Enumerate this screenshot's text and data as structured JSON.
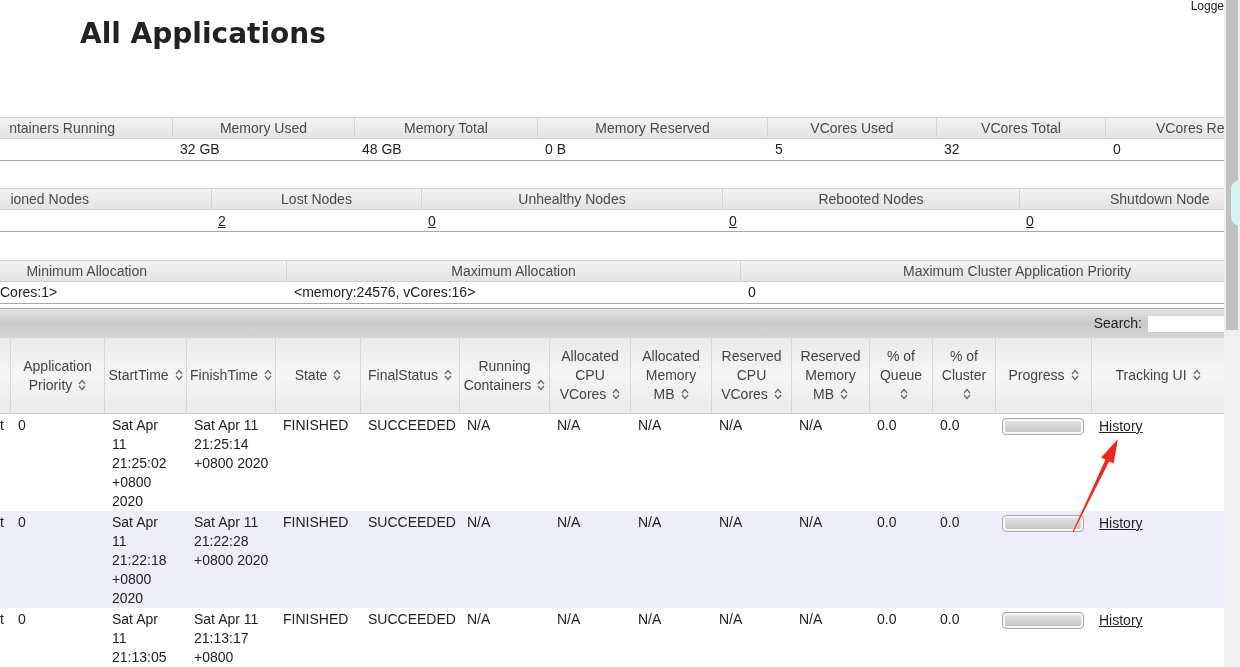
{
  "header": {
    "user_label": "Logge",
    "title": "All Applications"
  },
  "metric_tables": [
    {
      "columns": [
        {
          "label": "ntainers Running"
        },
        {
          "label": "Memory Used",
          "value": "32 GB",
          "kind": "text"
        },
        {
          "label": "Memory Total",
          "value": "48 GB",
          "kind": "text"
        },
        {
          "label": "Memory Reserved",
          "value": "0 B",
          "kind": "text"
        },
        {
          "label": "VCores Used",
          "value": "5",
          "kind": "text"
        },
        {
          "label": "VCores Total",
          "value": "32",
          "kind": "text"
        },
        {
          "label": "VCores Re",
          "value": "0",
          "kind": "text"
        }
      ]
    },
    {
      "columns": [
        {
          "label": "ioned Nodes"
        },
        {
          "label": "Lost Nodes",
          "value": "2",
          "kind": "link"
        },
        {
          "label": "Unhealthy Nodes",
          "value": "0",
          "kind": "link"
        },
        {
          "label": "Rebooted Nodes",
          "value": "0",
          "kind": "link"
        },
        {
          "label": "Shutdown Node",
          "value": "0",
          "kind": "link"
        }
      ]
    },
    {
      "columns": [
        {
          "label": "Minimum Allocation",
          "value": "Cores:1>",
          "kind": "text"
        },
        {
          "label": "Maximum Allocation",
          "value": "<memory:24576, vCores:16>",
          "kind": "text"
        },
        {
          "label": "Maximum Cluster Application Priority",
          "value": "0",
          "kind": "text"
        }
      ]
    }
  ],
  "applications_table": {
    "search": {
      "label": "Search:"
    },
    "columns": [
      {
        "label": "Application Priority",
        "sortable": true
      },
      {
        "label": "StartTime",
        "sortable": true
      },
      {
        "label": "FinishTime",
        "sortable": true
      },
      {
        "label": "State",
        "sortable": true
      },
      {
        "label": "FinalStatus",
        "sortable": true
      },
      {
        "label": "Running Containers",
        "sortable": true
      },
      {
        "label": "Allocated CPU VCores",
        "sortable": true
      },
      {
        "label": "Allocated Memory MB",
        "sortable": true
      },
      {
        "label": "Reserved CPU VCores",
        "sortable": true
      },
      {
        "label": "Reserved Memory MB",
        "sortable": true
      },
      {
        "label": "% of Queue",
        "sortable": true
      },
      {
        "label": "% of Cluster",
        "sortable": true
      },
      {
        "label": "Progress",
        "sortable": true
      },
      {
        "label": "Tracking UI",
        "sortable": true
      }
    ],
    "rows": [
      {
        "column_1": "t",
        "cells": [
          "0",
          "Sat Apr 11 21:25:02 +0800 2020",
          "Sat Apr 11 21:25:14 +0800 2020",
          "FINISHED",
          "SUCCEEDED",
          "N/A",
          "N/A",
          "N/A",
          "N/A",
          "N/A",
          "0.0",
          "0.0"
        ],
        "progress": {
          "level": 1
        },
        "tracking_ui": "History"
      },
      {
        "column_1": "t",
        "cells": [
          "0",
          "Sat Apr 11 21:22:18 +0800 2020",
          "Sat Apr 11 21:22:28 +0800 2020",
          "FINISHED",
          "SUCCEEDED",
          "N/A",
          "N/A",
          "N/A",
          "N/A",
          "N/A",
          "0.0",
          "0.0"
        ],
        "progress": {
          "level": 1
        },
        "tracking_ui": "History"
      },
      {
        "column_1": "t",
        "cells": [
          "0",
          "Sat Apr 11 21:13:05",
          "Sat Apr 11 21:13:17 +0800",
          "FINISHED",
          "SUCCEEDED",
          "N/A",
          "N/A",
          "N/A",
          "N/A",
          "N/A",
          "0.0",
          "0.0"
        ],
        "progress": {
          "level": 1
        },
        "tracking_ui": "History"
      }
    ]
  }
}
